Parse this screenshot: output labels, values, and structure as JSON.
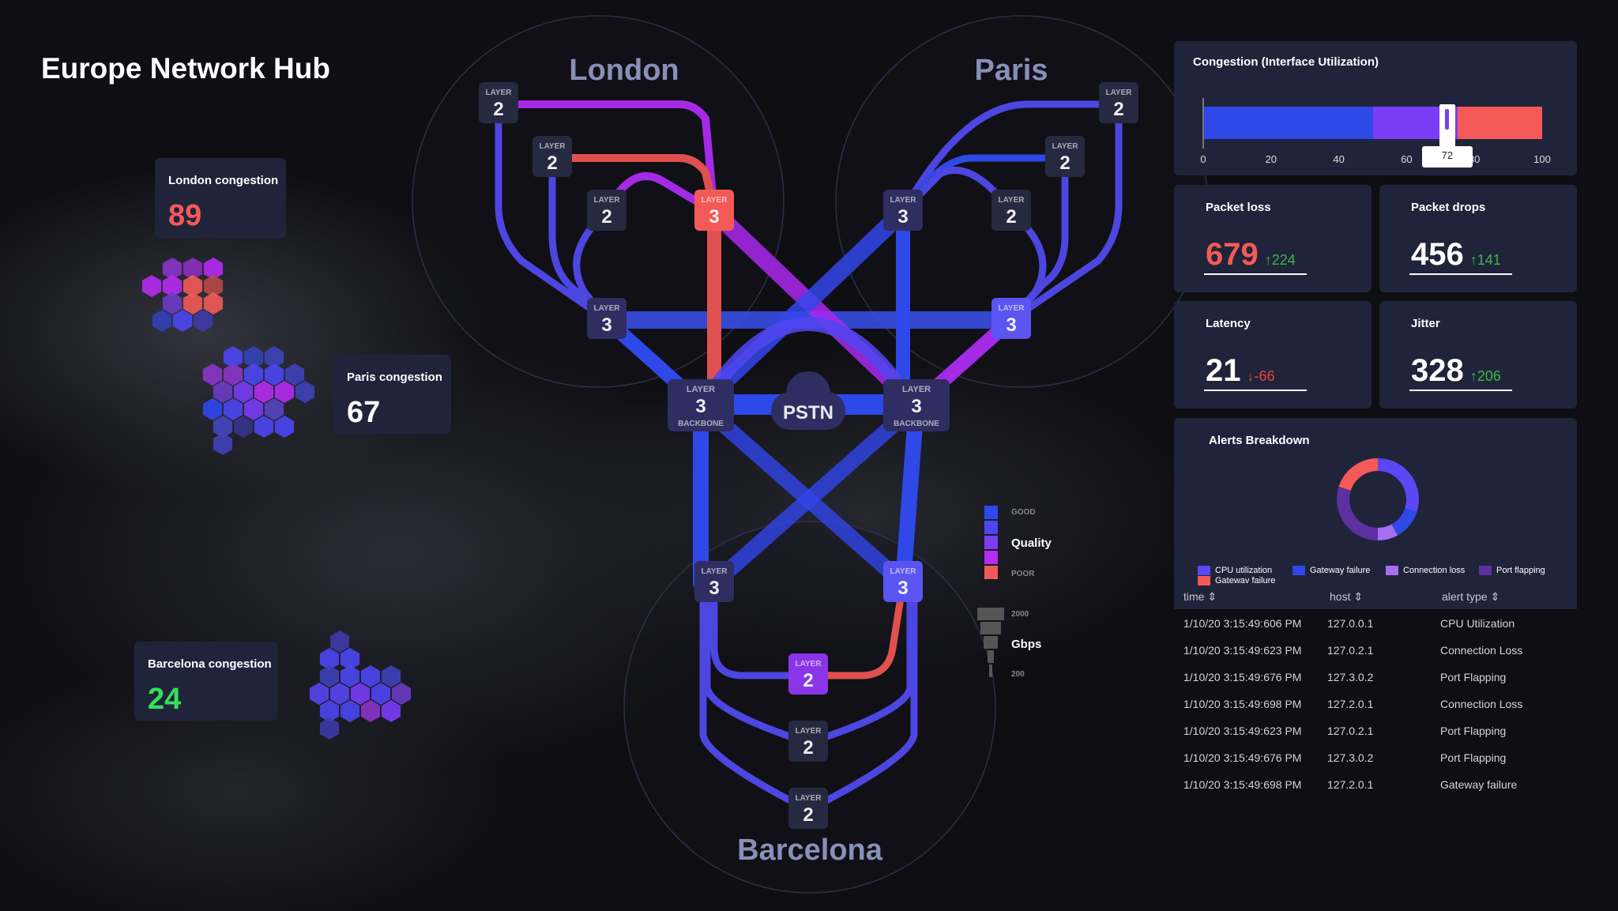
{
  "title": "Europe Network Hub",
  "cities": {
    "london": "London",
    "paris": "Paris",
    "barcelona": "Barcelona"
  },
  "congestion_cards": [
    {
      "label": "London congestion",
      "value": "89",
      "color": "#f35a57"
    },
    {
      "label": "Paris congestion",
      "value": "67",
      "color": "#ffffff"
    },
    {
      "label": "Barcelona congestion",
      "value": "24",
      "color": "#35e05a"
    }
  ],
  "nodes": {
    "layer": "LAYER",
    "backbone": "BACKBONE",
    "pstn": "PSTN",
    "l2": "2",
    "l3": "3"
  },
  "quality_legend": {
    "good": "GOOD",
    "title": "Quality",
    "poor": "POOR",
    "colors": [
      "#2f48f0",
      "#4d46f2",
      "#7a3cf5",
      "#b52cf2",
      "#f35a57"
    ]
  },
  "gbps_legend": {
    "max": "2000",
    "title": "Gbps",
    "min": "200"
  },
  "gauge": {
    "title": "Congestion (Interface Utilization)",
    "value": 72,
    "value_label": "72",
    "ticks": [
      "0",
      "20",
      "40",
      "60",
      "80",
      "100"
    ],
    "segments": [
      {
        "from": 0,
        "to": 50,
        "color": "#2f48e8"
      },
      {
        "from": 50,
        "to": 75,
        "color": "#7b3cf5"
      },
      {
        "from": 75,
        "to": 100,
        "color": "#f35a57"
      }
    ]
  },
  "metrics": [
    {
      "label": "Packet loss",
      "value": "679",
      "delta": "↑224",
      "dir": "up",
      "value_color": "#f35a57"
    },
    {
      "label": "Packet drops",
      "value": "456",
      "delta": "↑141",
      "dir": "up",
      "value_color": "#ffffff"
    },
    {
      "label": "Latency",
      "value": "21",
      "delta": "↓-66",
      "dir": "down",
      "value_color": "#ffffff"
    },
    {
      "label": "Jitter",
      "value": "328",
      "delta": "↑206",
      "dir": "up",
      "value_color": "#ffffff"
    }
  ],
  "alerts": {
    "title": "Alerts Breakdown",
    "chart_data": {
      "type": "pie",
      "slices": [
        {
          "name": "CPU utilization",
          "value": 30,
          "color": "#5a48f5"
        },
        {
          "name": "Gateway failure",
          "value": 12,
          "color": "#2f48e8"
        },
        {
          "name": "Connection loss",
          "value": 8,
          "color": "#a66ef0"
        },
        {
          "name": "Port flapping",
          "value": 30,
          "color": "#5e2fa0"
        },
        {
          "name": "Gatewav failure",
          "value": 20,
          "color": "#f35a57"
        }
      ]
    }
  },
  "table": {
    "headers": [
      "time",
      "host",
      "alert type"
    ],
    "rows": [
      [
        "1/10/20 3:15:49:606 PM",
        "127.0.0.1",
        "CPU Utilization"
      ],
      [
        "1/10/20 3:15:49:623 PM",
        "127.0.2.1",
        "Connection Loss"
      ],
      [
        "1/10/20 3:15:49:676 PM",
        "127.3.0.2",
        "Port Flapping"
      ],
      [
        "1/10/20 3:15:49:698 PM",
        "127.2.0.1",
        "Connection Loss"
      ],
      [
        "1/10/20 3:15:49:623 PM",
        "127.0.2.1",
        "Port Flapping"
      ],
      [
        "1/10/20 3:15:49:676 PM",
        "127.3.0.2",
        "Port Flapping"
      ],
      [
        "1/10/20 3:15:49:698 PM",
        "127.2.0.1",
        "Gateway failure"
      ]
    ]
  }
}
